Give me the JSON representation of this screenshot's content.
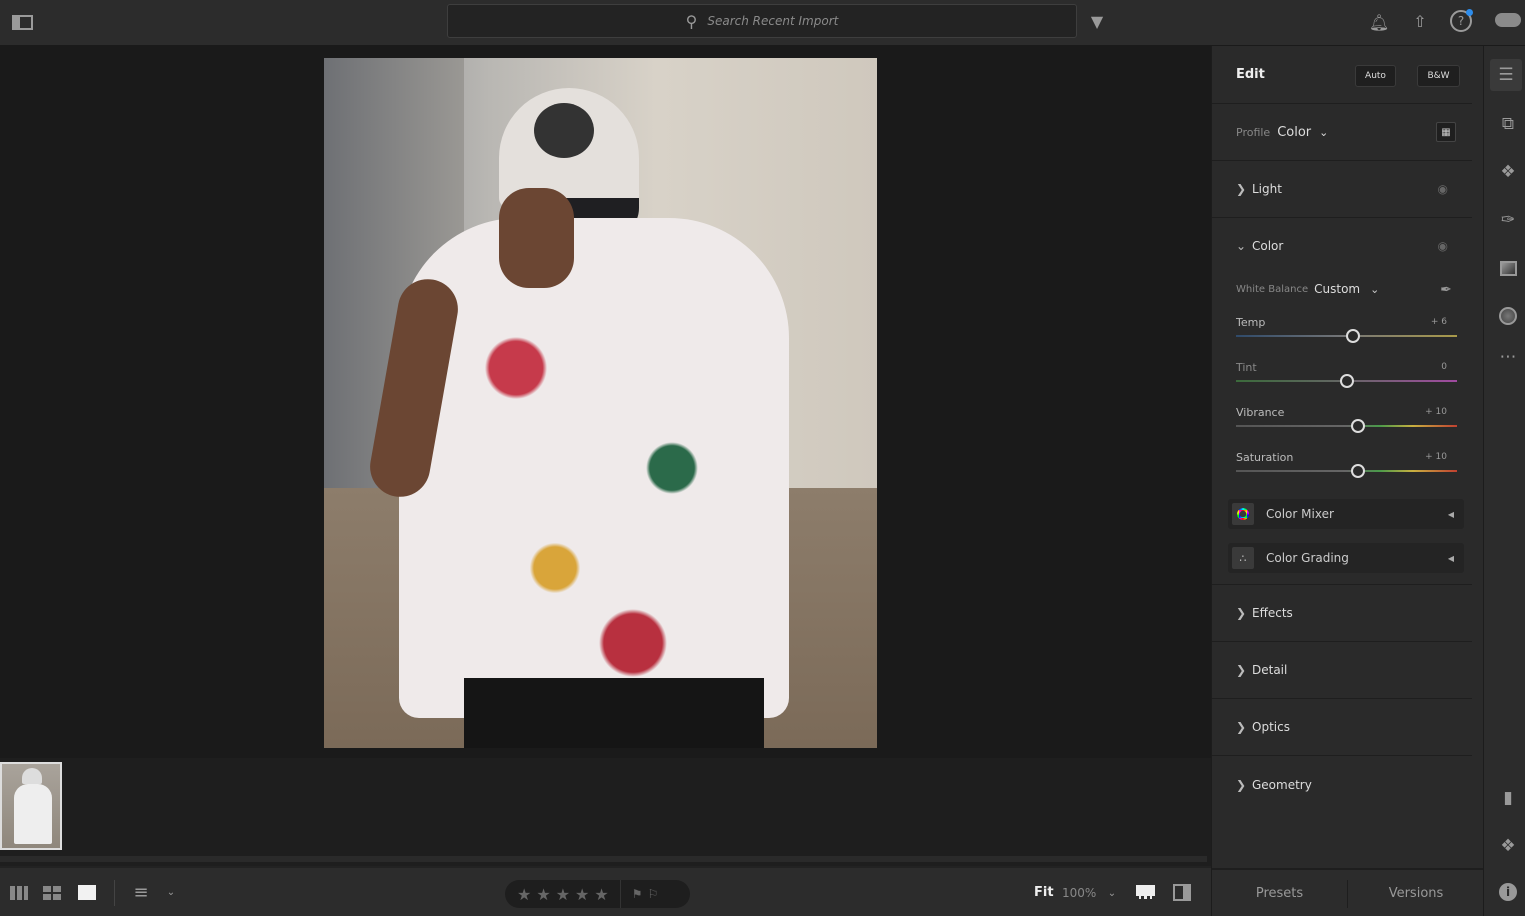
{
  "topbar": {
    "search_placeholder": "Search Recent Import",
    "icons": [
      "panel-toggle-icon",
      "search-icon",
      "filter-icon",
      "bell-icon",
      "share-icon",
      "help-icon",
      "cloud-icon"
    ]
  },
  "panel": {
    "title": "Edit",
    "auto_label": "Auto",
    "bw_label": "B&W",
    "profile_label": "Profile",
    "profile_value": "Color",
    "sections": {
      "light": "Light",
      "color": "Color",
      "effects": "Effects",
      "detail": "Detail",
      "optics": "Optics",
      "geometry": "Geometry"
    },
    "white_balance_label": "White Balance",
    "white_balance_value": "Custom",
    "sliders": [
      {
        "label": "Temp",
        "display": "+ 6",
        "value": 6
      },
      {
        "label": "Tint",
        "display": "0",
        "value": 0
      },
      {
        "label": "Vibrance",
        "display": "+ 10",
        "value": 10
      },
      {
        "label": "Saturation",
        "display": "+ 10",
        "value": 10
      }
    ],
    "color_mixer": "Color Mixer",
    "color_grading": "Color Grading",
    "presets": "Presets",
    "versions": "Versions"
  },
  "bottombar": {
    "fit": "Fit",
    "zoom": "100%",
    "rating": 0
  },
  "colors": {
    "accent_dot": "#2d8ceb"
  }
}
